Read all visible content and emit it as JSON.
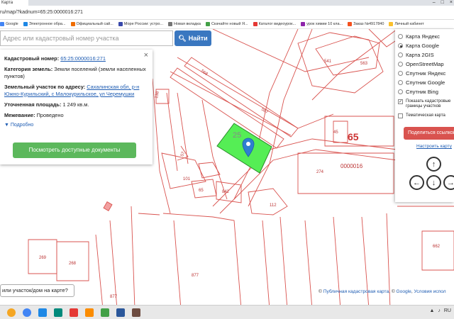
{
  "browser": {
    "tab_label": "Карта",
    "url": "ru/map/?kadnum=65:25:0000016:271",
    "bookmarks": [
      {
        "label": "Google",
        "color": "#4285f4"
      },
      {
        "label": "Электронное обра...",
        "color": "#1e88e5"
      },
      {
        "label": "Официальный сай...",
        "color": "#ef6c00"
      },
      {
        "label": "Море России: устро...",
        "color": "#3949ab"
      },
      {
        "label": "Новая вкладка",
        "color": "#757575"
      },
      {
        "label": "Скачайте новый Я...",
        "color": "#43a047"
      },
      {
        "label": "Каталог видеоурок...",
        "color": "#e53935"
      },
      {
        "label": "урок химии 10 кла...",
        "color": "#8e24aa"
      },
      {
        "label": "Заказ №4917840",
        "color": "#f4511e"
      },
      {
        "label": "Личный кабинет",
        "color": "#fbc02d"
      }
    ]
  },
  "search": {
    "placeholder": "Адрес или кадастровый номер участка",
    "button_label": "Найти"
  },
  "info": {
    "cadastral_label": "Кадастровый номер:",
    "cadastral_value": "65:25:0000016:271",
    "category_label": "Категория земель:",
    "category_value": "Земли поселений (земли населенных пунктов)",
    "address_label": "Земельный участок по адресу:",
    "address_value": "Сахалинская обл, р-н Южно-Курильский, с Малокурильское, ул Черемушки",
    "area_label": "Уточненная площадь:",
    "area_value": "1 249 кв.м.",
    "survey_label": "Межевание:",
    "survey_value": "Проведено",
    "more_label": "Подробно",
    "docs_button": "Посмотреть доступные документы"
  },
  "layers": {
    "options": [
      {
        "label": "Карта Яндекс",
        "selected": false
      },
      {
        "label": "Карта Google",
        "selected": true
      },
      {
        "label": "Карта 2GIS",
        "selected": false
      },
      {
        "label": "OpenStreetMap",
        "selected": false
      },
      {
        "label": "Спутник Яндекс",
        "selected": false
      },
      {
        "label": "Спутник Google",
        "selected": false
      },
      {
        "label": "Спутник Bing",
        "selected": false
      }
    ],
    "show_boundaries_label": "Показать кадастровые границы участков",
    "thematic_label": "Тематическая карта",
    "share_button": "Поделиться ссылкой",
    "setup_link": "Настроить карту"
  },
  "map": {
    "labels": [
      {
        "text": "541"
      },
      {
        "text": "563"
      },
      {
        "text": "568"
      },
      {
        "text": "567"
      },
      {
        "text": "138"
      },
      {
        "text": "25"
      },
      {
        "text": "65"
      },
      {
        "text": "45"
      },
      {
        "text": "274"
      },
      {
        "text": "0000016"
      },
      {
        "text": "101"
      },
      {
        "text": "842"
      },
      {
        "text": "112"
      },
      {
        "text": "269"
      },
      {
        "text": "268"
      },
      {
        "text": "877"
      },
      {
        "text": "662"
      },
      {
        "text": "57"
      },
      {
        "text": "65"
      }
    ],
    "highlight_color": "#55ee55",
    "line_color": "#d9534f"
  },
  "question": "или участок/дом на карте?",
  "attribution": {
    "pkk": "Публичная кадастровая карта",
    "google": "Google",
    "terms": "Условия испол"
  },
  "taskbar": {
    "tray_lang": "RU"
  }
}
